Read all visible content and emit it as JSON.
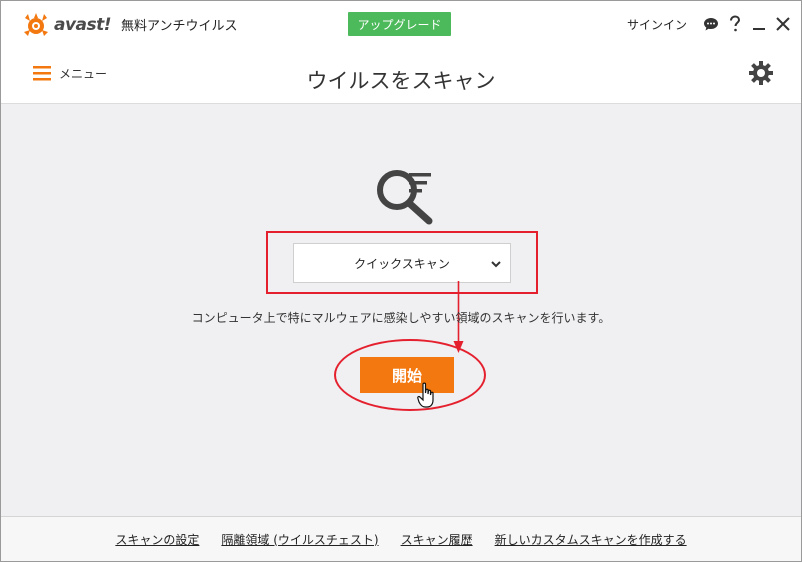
{
  "titlebar": {
    "logo_text": "avast!",
    "product_name": "無料アンチウイルス",
    "upgrade_label": "アップグレード",
    "signin_label": "サインイン"
  },
  "header": {
    "menu_label": "メニュー",
    "title": "ウイルスをスキャン"
  },
  "main": {
    "scan_type": "クイックスキャン",
    "description": "コンピュータ上で特にマルウェアに感染しやすい領域のスキャンを行います。",
    "start_label": "開始"
  },
  "footer": {
    "links": [
      "スキャンの設定",
      "隔離領域 (ウイルスチェスト)",
      "スキャン履歴",
      "新しいカスタムスキャンを作成する"
    ]
  },
  "colors": {
    "brand_orange": "#f3780f",
    "upgrade_green": "#4cb95a",
    "annotation_red": "#e5202e"
  }
}
